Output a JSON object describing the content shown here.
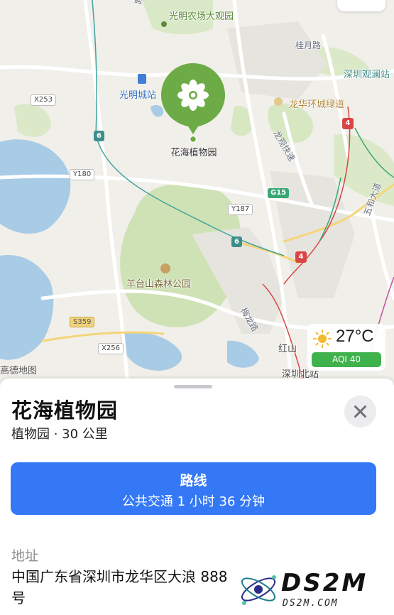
{
  "map": {
    "attribution": "高德地图",
    "labels": {
      "poi_top": "光明农场大观园",
      "road_guiyue": "桂月路",
      "poi_longhua": "龙华环城绿道",
      "guanlan": "深圳观澜站",
      "station_guangming": "光明城站",
      "road_longguan": "龙观快速",
      "forest_park": "羊台山森林公园",
      "road_meilong": "梅龙路",
      "hongshan": "红山",
      "shenzhen_north": "深圳北站",
      "wuhe": "五和大道",
      "road_fragment": "路",
      "route_x253": "X253",
      "route_y180": "Y180",
      "route_y187": "Y187",
      "route_x256": "X256",
      "route_s359": "S359",
      "route_g15": "G15",
      "shield_6a": "6",
      "shield_6b": "6",
      "shield_4a": "4",
      "shield_4b": "4"
    },
    "pin": {
      "label": "花海植物园",
      "icon": "flower-icon",
      "color": "#6cab45"
    },
    "weather": {
      "temperature": "27°C",
      "aqi": "AQI 40",
      "icon": "sun-icon"
    }
  },
  "sheet": {
    "title": "花海植物园",
    "subtitle": "植物园 · 30 公里",
    "close_icon": "close-icon",
    "route_button": {
      "label": "路线",
      "detail": "公共交通 1 小时 36 分钟",
      "color": "#3478f6"
    },
    "address": {
      "label": "地址",
      "value": "中国广东省深圳市龙华区大浪 888 号"
    }
  },
  "watermark": {
    "name": "DS2M",
    "domain": "DS2M.COM"
  }
}
